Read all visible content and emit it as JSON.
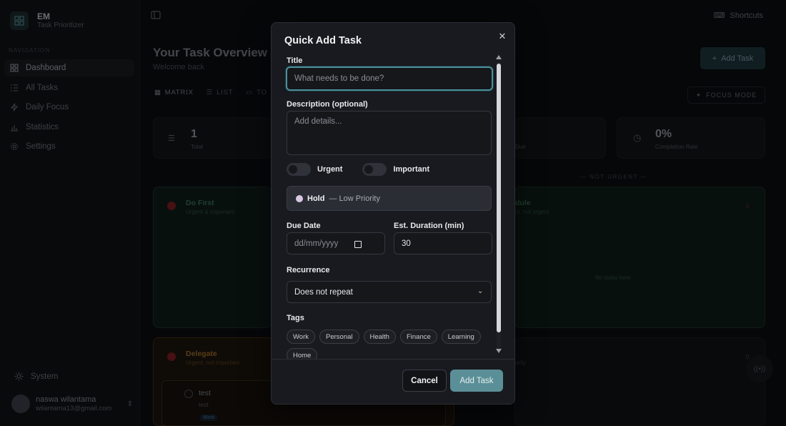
{
  "app": {
    "logo_text": "EM",
    "subtitle": "Task Prioritizer"
  },
  "sidebar": {
    "section_label": "NAVIGATION",
    "items": [
      {
        "label": "Dashboard",
        "icon": "grid-icon",
        "active": true
      },
      {
        "label": "All Tasks",
        "icon": "list-check-icon",
        "active": false
      },
      {
        "label": "Daily Focus",
        "icon": "bolt-icon",
        "active": false
      },
      {
        "label": "Statistics",
        "icon": "bar-chart-icon",
        "active": false
      },
      {
        "label": "Settings",
        "icon": "gear-icon",
        "active": false
      }
    ],
    "system_label": "System",
    "user": {
      "name": "naswa wilantama",
      "email": "wilantama13@gmail.com"
    }
  },
  "header": {
    "shortcuts_label": "Shortcuts"
  },
  "main": {
    "title": "Your Task Overview",
    "subtitle": "Welcome back",
    "add_task_label": "Add Task",
    "tabs": [
      "MATRIX",
      "LIST",
      "TO"
    ],
    "focus_mode_label": "FOCUS MODE",
    "stats": {
      "total_value": "1",
      "total_label": "Total",
      "due_label": "Due",
      "completion_value": "0%",
      "completion_label": "Completion Rate"
    },
    "not_urgent_label": "— NOT URGENT —",
    "quadrants": {
      "do_first": {
        "title": "Do First",
        "subtitle": "Urgent & Important"
      },
      "schedule": {
        "title": "dule",
        "subtitle": "nt, not urgent",
        "count": "0",
        "empty": "No tasks here"
      },
      "delegate": {
        "title": "Delegate",
        "subtitle": "Urgent, not important",
        "count": "0"
      },
      "eliminate": {
        "subtitle": "urity"
      }
    },
    "task": {
      "title": "test",
      "description": "test",
      "tag": "Work"
    }
  },
  "modal": {
    "title": "Quick Add Task",
    "title_label": "Title",
    "title_placeholder": "What needs to be done?",
    "description_label": "Description (optional)",
    "description_placeholder": "Add details...",
    "urgent_label": "Urgent",
    "important_label": "Important",
    "priority_name": "Hold",
    "priority_desc": "— Low Priority",
    "due_date_label": "Due Date",
    "due_date_placeholder": "dd/mm/yyyy",
    "duration_label": "Est. Duration (min)",
    "duration_value": "30",
    "recurrence_label": "Recurrence",
    "recurrence_value": "Does not repeat",
    "tags_label": "Tags",
    "tags": [
      "Work",
      "Personal",
      "Health",
      "Finance",
      "Learning",
      "Home"
    ],
    "cancel_label": "Cancel",
    "submit_label": "Add Task"
  },
  "colors": {
    "accent": "#5b8f97",
    "focus_ring": "#4a8f99",
    "priority_dot": "#d9c7e3"
  }
}
